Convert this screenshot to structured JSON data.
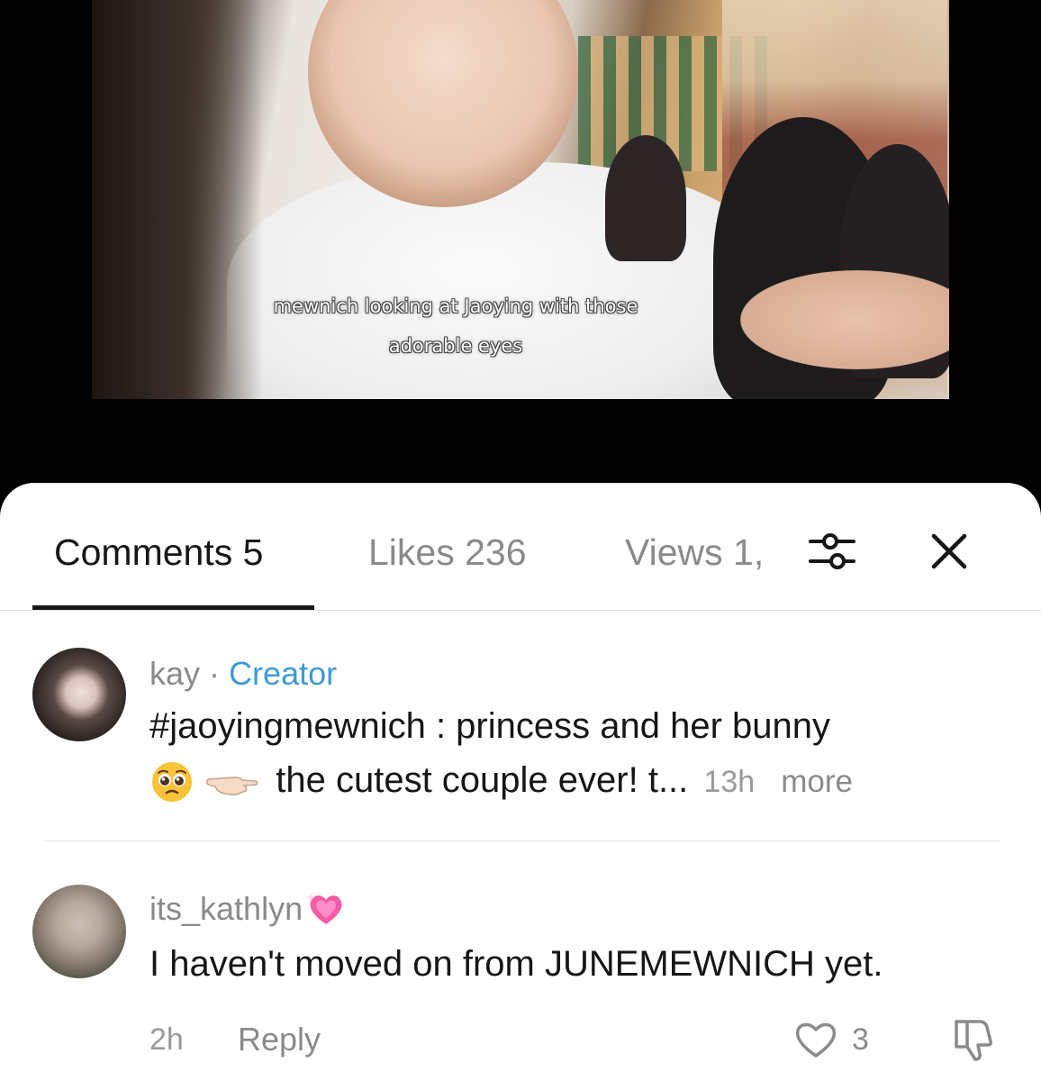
{
  "video": {
    "subtitle_line1": "mewnich looking at Jaoying with those",
    "subtitle_line2": "adorable eyes"
  },
  "tabs": {
    "comments": "Comments 5",
    "likes": "Likes 236",
    "views": "Views 1,",
    "active": "comments"
  },
  "icons": {
    "filter": "sliders-icon",
    "close": "close-icon"
  },
  "comments": [
    {
      "user": "kay",
      "separator": "·",
      "badge": "Creator",
      "badge_color": "#3c9bd6",
      "line1": "#jaoyingmewnich : princess and her bunny",
      "line2_text": "the cutest couple ever! t...",
      "emojis": [
        "pleading-face",
        "pointing-hand"
      ],
      "time": "13h",
      "more": "more"
    },
    {
      "user": "its_kathlyn",
      "user_emoji": "sparkling-heart",
      "text": "I haven't moved on from JUNEMEWNICH yet.",
      "time": "2h",
      "reply": "Reply",
      "likes": "3"
    }
  ],
  "colors": {
    "background": "#000000",
    "sheet": "#ffffff",
    "text_primary": "#161616",
    "text_secondary": "#8a8a8a",
    "accent": "#3c9bd6"
  }
}
